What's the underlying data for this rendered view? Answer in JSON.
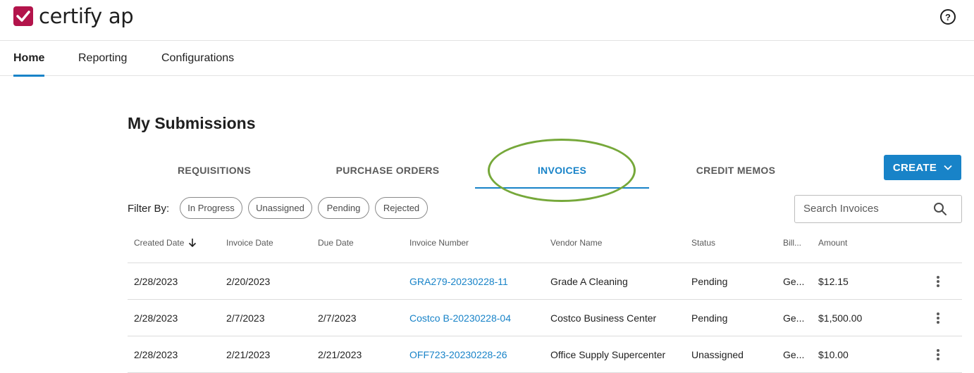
{
  "app": {
    "logo_text": "certify ap"
  },
  "nav": {
    "items": [
      {
        "label": "Home",
        "active": true
      },
      {
        "label": "Reporting",
        "active": false
      },
      {
        "label": "Configurations",
        "active": false
      }
    ]
  },
  "page_title": "My Submissions",
  "tabs": [
    {
      "label": "REQUISITIONS",
      "active": false
    },
    {
      "label": "PURCHASE ORDERS",
      "active": false
    },
    {
      "label": "INVOICES",
      "active": true
    },
    {
      "label": "CREDIT MEMOS",
      "active": false
    }
  ],
  "create_button": {
    "label": "CREATE"
  },
  "filters": {
    "label": "Filter By:",
    "chips": [
      "In Progress",
      "Unassigned",
      "Pending",
      "Rejected"
    ]
  },
  "search": {
    "placeholder": "Search Invoices"
  },
  "table": {
    "columns": [
      "Created Date",
      "Invoice Date",
      "Due Date",
      "Invoice Number",
      "Vendor Name",
      "Status",
      "Bill...",
      "Amount"
    ],
    "sort_column": "Created Date",
    "rows": [
      {
        "created": "2/28/2023",
        "invoice_date": "2/20/2023",
        "due_date": "",
        "number": "GRA279-20230228-11",
        "vendor": "Grade A Cleaning",
        "status": "Pending",
        "bill": "Ge...",
        "amount": "$12.15"
      },
      {
        "created": "2/28/2023",
        "invoice_date": "2/7/2023",
        "due_date": "2/7/2023",
        "number": "Costco B-20230228-04",
        "vendor": "Costco Business Center",
        "status": "Pending",
        "bill": "Ge...",
        "amount": "$1,500.00"
      },
      {
        "created": "2/28/2023",
        "invoice_date": "2/21/2023",
        "due_date": "2/21/2023",
        "number": "OFF723-20230228-26",
        "vendor": "Office Supply Supercenter",
        "status": "Unassigned",
        "bill": "Ge...",
        "amount": "$10.00"
      }
    ]
  },
  "colors": {
    "brand": "#b3144b",
    "accent": "#1883c8",
    "highlight": "#76a83a"
  }
}
